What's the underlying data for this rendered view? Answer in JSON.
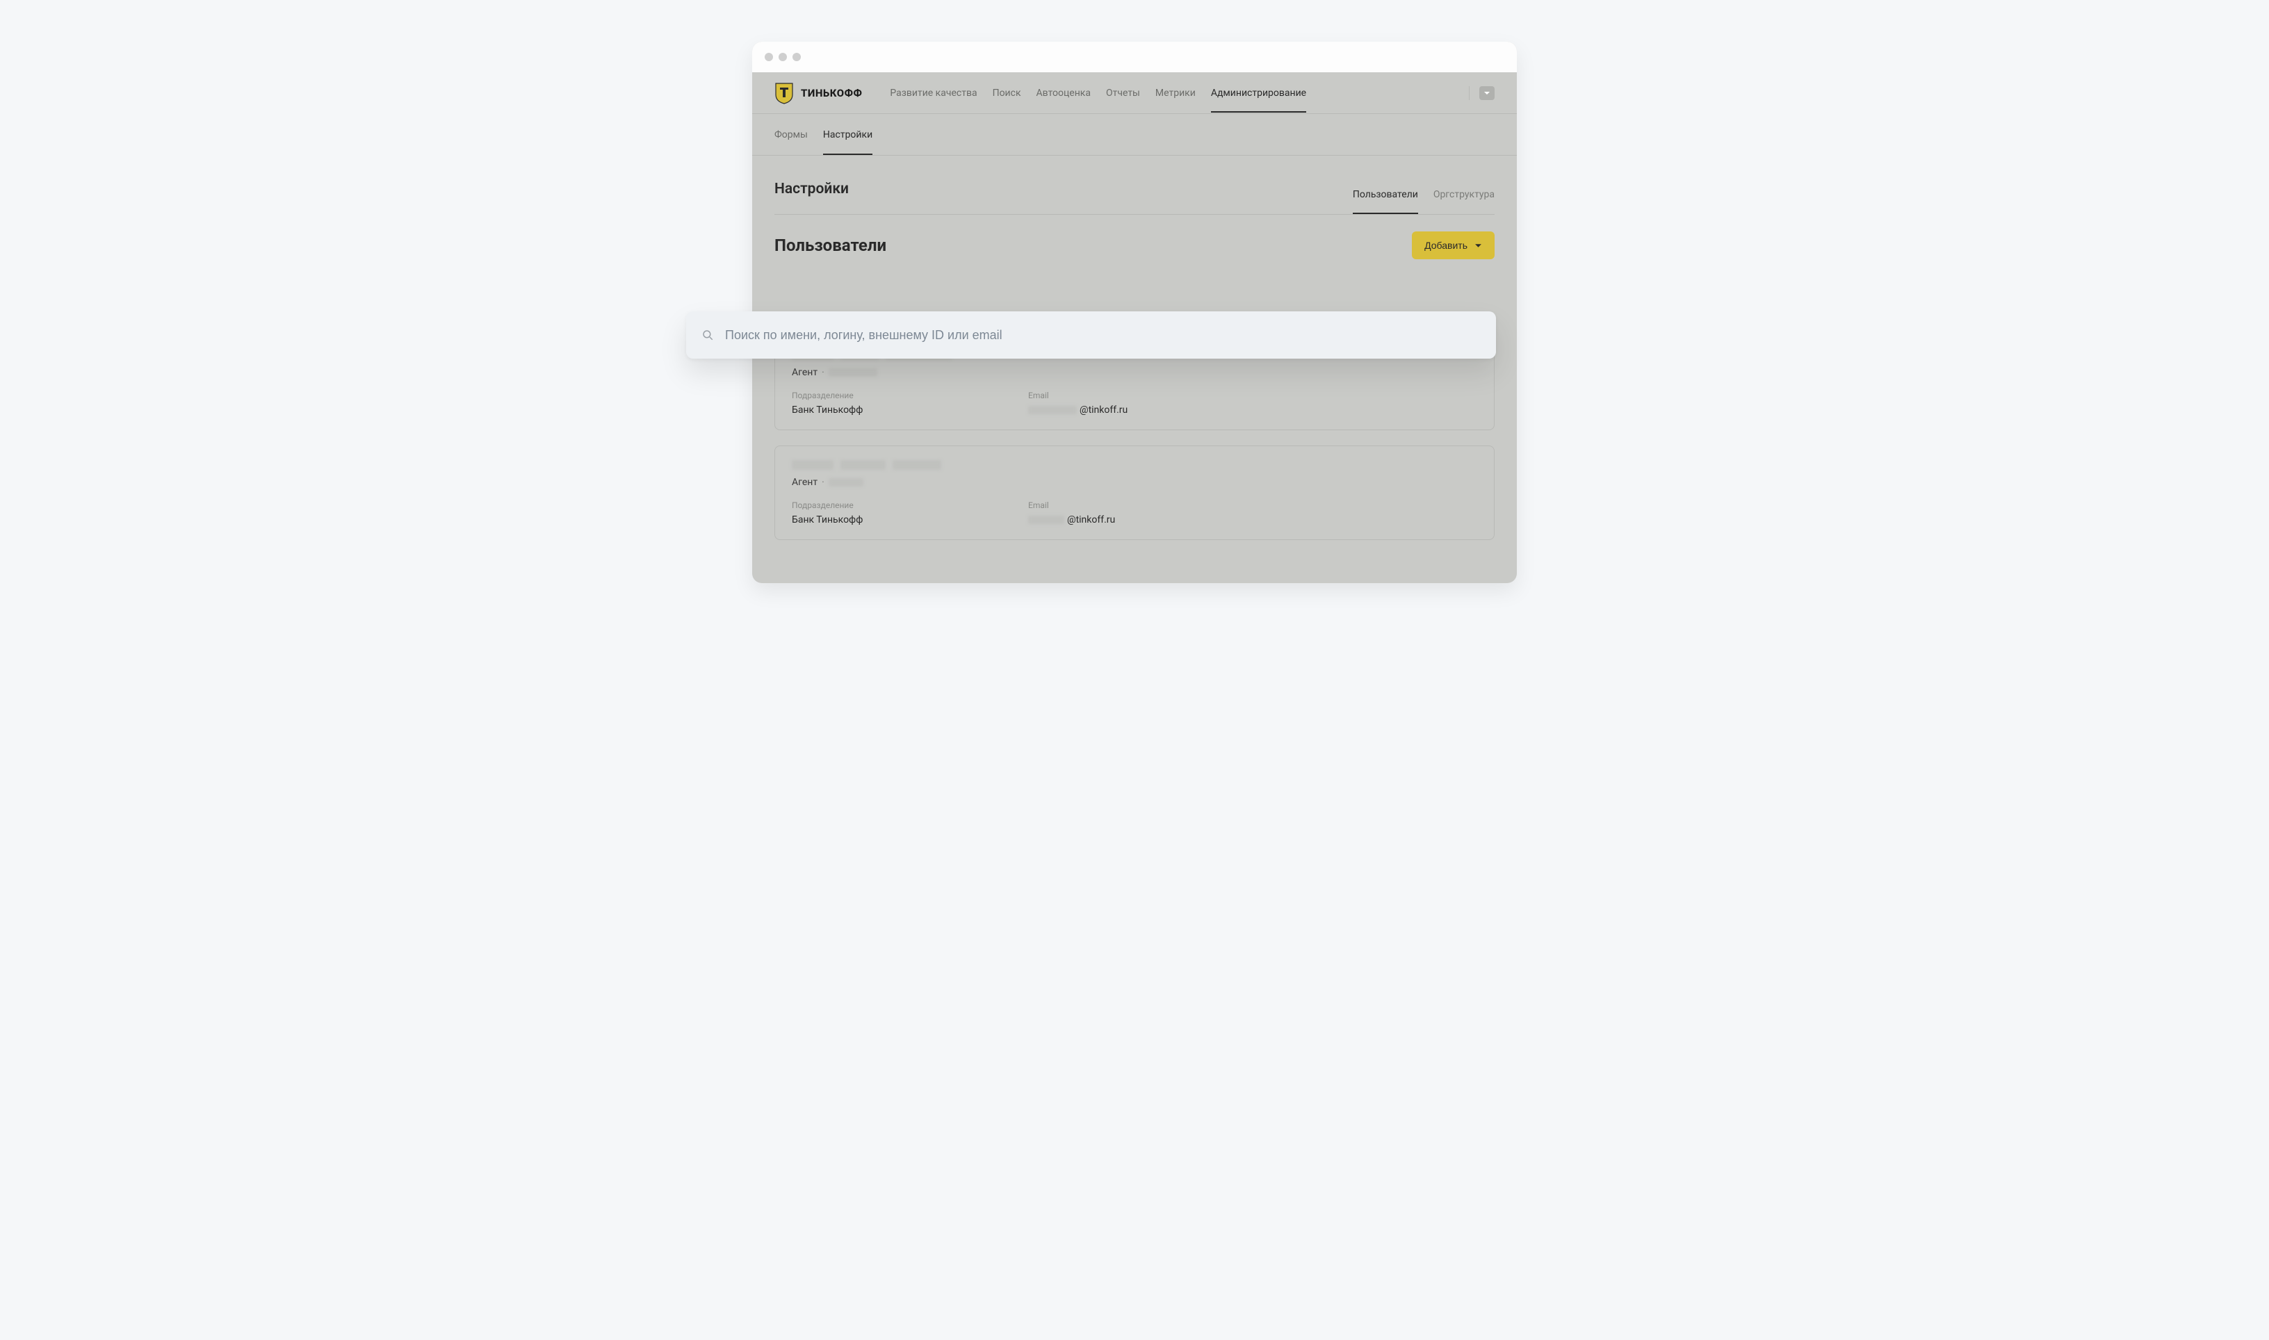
{
  "brand": "ТИНЬКОФФ",
  "nav": {
    "items": [
      {
        "label": "Развитие качества",
        "active": false
      },
      {
        "label": "Поиск",
        "active": false
      },
      {
        "label": "Автооценка",
        "active": false
      },
      {
        "label": "Отчеты",
        "active": false
      },
      {
        "label": "Метрики",
        "active": false
      },
      {
        "label": "Администрирование",
        "active": true
      }
    ]
  },
  "subnav": {
    "items": [
      {
        "label": "Формы",
        "active": false
      },
      {
        "label": "Настройки",
        "active": true
      }
    ]
  },
  "settings": {
    "title": "Настройки",
    "tabs": [
      {
        "label": "Пользователи",
        "active": true
      },
      {
        "label": "Оргструктура",
        "active": false
      }
    ]
  },
  "users": {
    "title": "Пользователи",
    "add_label": "Добавить"
  },
  "search": {
    "placeholder": "Поиск по имени, логину, внешнему ID или email"
  },
  "labels": {
    "department": "Подразделение",
    "email": "Email"
  },
  "cards": [
    {
      "role": "Агент",
      "department": "Банк Тинькофф",
      "email_domain": "@tinkoff.ru"
    },
    {
      "role": "Агент",
      "department": "Банк Тинькофф",
      "email_domain": "@tinkoff.ru"
    }
  ]
}
